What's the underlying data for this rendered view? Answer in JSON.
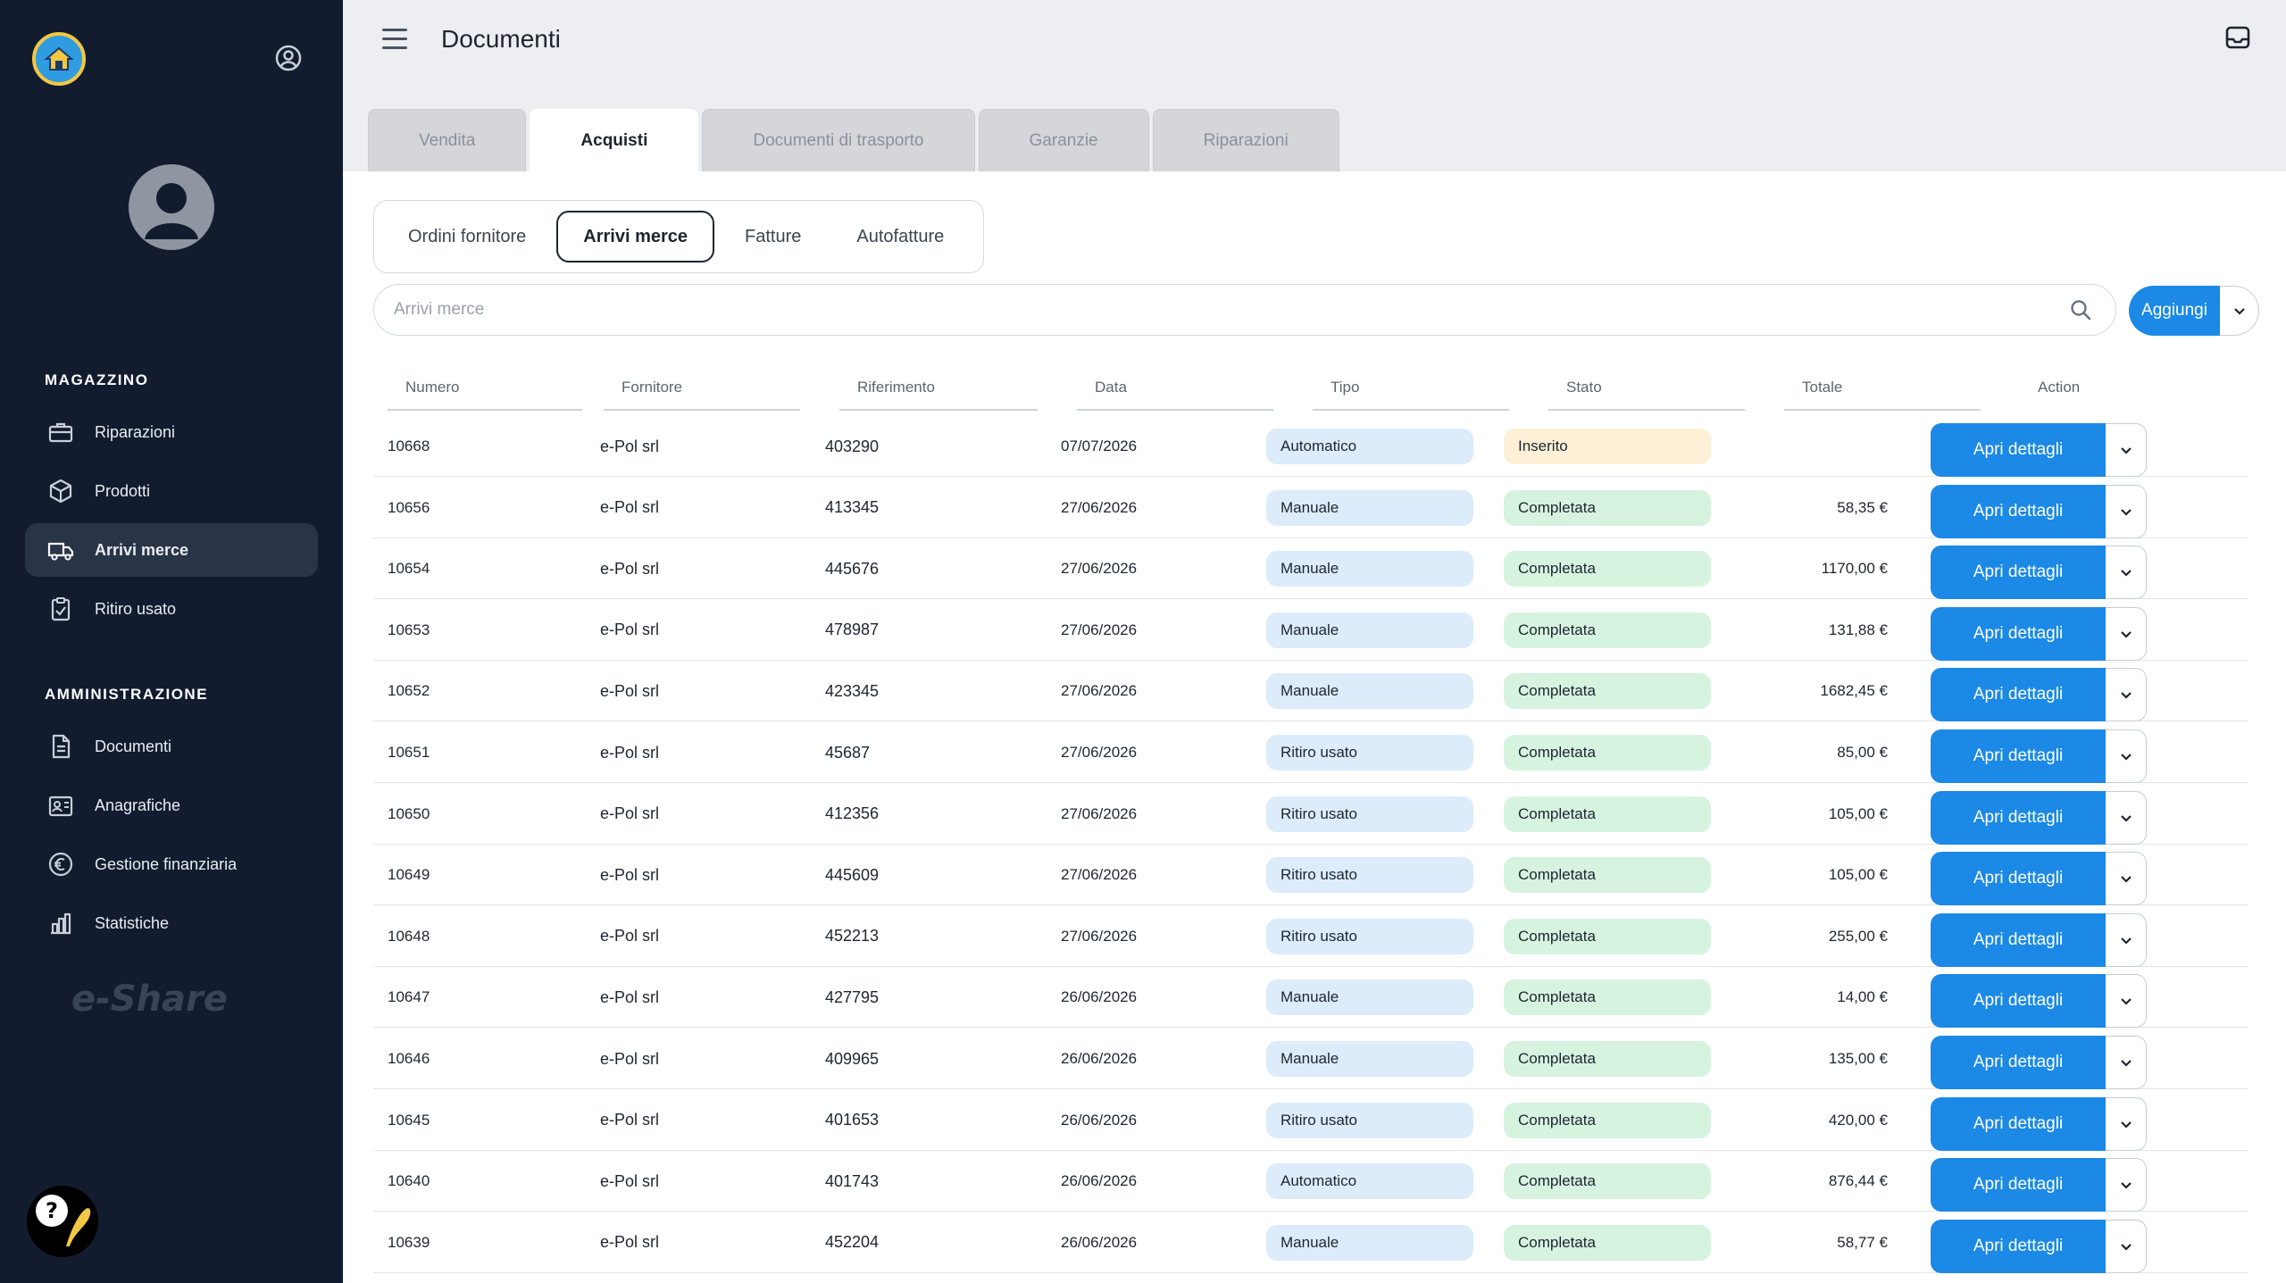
{
  "app": {
    "page_title": "Documenti",
    "brand_watermark": "e-Share"
  },
  "sidebar": {
    "sections": [
      {
        "title": "MAGAZZINO",
        "items": [
          {
            "label": "Riparazioni",
            "icon": "toolbox-icon"
          },
          {
            "label": "Prodotti",
            "icon": "box-icon"
          },
          {
            "label": "Arrivi merce",
            "icon": "truck-icon",
            "active": true
          },
          {
            "label": "Ritiro usato",
            "icon": "clipboard-icon"
          }
        ]
      },
      {
        "title": "AMMINISTRAZIONE",
        "items": [
          {
            "label": "Documenti",
            "icon": "document-icon"
          },
          {
            "label": "Anagrafiche",
            "icon": "contacts-icon"
          },
          {
            "label": "Gestione finanziaria",
            "icon": "euro-icon"
          },
          {
            "label": "Statistiche",
            "icon": "bar-chart-icon"
          }
        ]
      }
    ]
  },
  "tabs": [
    {
      "label": "Vendita",
      "active": false
    },
    {
      "label": "Acquisti",
      "active": true
    },
    {
      "label": "Documenti di trasporto",
      "active": false
    },
    {
      "label": "Garanzie",
      "active": false
    },
    {
      "label": "Riparazioni",
      "active": false
    }
  ],
  "subtabs": [
    {
      "label": "Ordini fornitore",
      "active": false
    },
    {
      "label": "Arrivi merce",
      "active": true
    },
    {
      "label": "Fatture",
      "active": false
    },
    {
      "label": "Autofatture",
      "active": false
    }
  ],
  "search": {
    "placeholder": "Arrivi merce",
    "value": ""
  },
  "add_button": {
    "label": "Aggiungi"
  },
  "table": {
    "columns": [
      "Numero",
      "Fornitore",
      "Riferimento",
      "Data",
      "Tipo",
      "Stato",
      "Totale",
      "Action"
    ],
    "action_label": "Apri dettagli",
    "rows": [
      {
        "numero": "10668",
        "fornitore": "e-Pol srl",
        "riferimento": "403290",
        "data": "07/07/2026",
        "tipo": "Automatico",
        "stato": "Inserito",
        "totale": ""
      },
      {
        "numero": "10656",
        "fornitore": "e-Pol srl",
        "riferimento": "413345",
        "data": "27/06/2026",
        "tipo": "Manuale",
        "stato": "Completata",
        "totale": "58,35 €"
      },
      {
        "numero": "10654",
        "fornitore": "e-Pol srl",
        "riferimento": "445676",
        "data": "27/06/2026",
        "tipo": "Manuale",
        "stato": "Completata",
        "totale": "1170,00 €"
      },
      {
        "numero": "10653",
        "fornitore": "e-Pol srl",
        "riferimento": "478987",
        "data": "27/06/2026",
        "tipo": "Manuale",
        "stato": "Completata",
        "totale": "131,88 €"
      },
      {
        "numero": "10652",
        "fornitore": "e-Pol srl",
        "riferimento": "423345",
        "data": "27/06/2026",
        "tipo": "Manuale",
        "stato": "Completata",
        "totale": "1682,45 €"
      },
      {
        "numero": "10651",
        "fornitore": "e-Pol srl",
        "riferimento": "45687",
        "data": "27/06/2026",
        "tipo": "Ritiro usato",
        "stato": "Completata",
        "totale": "85,00 €"
      },
      {
        "numero": "10650",
        "fornitore": "e-Pol srl",
        "riferimento": "412356",
        "data": "27/06/2026",
        "tipo": "Ritiro usato",
        "stato": "Completata",
        "totale": "105,00 €"
      },
      {
        "numero": "10649",
        "fornitore": "e-Pol srl",
        "riferimento": "445609",
        "data": "27/06/2026",
        "tipo": "Ritiro usato",
        "stato": "Completata",
        "totale": "105,00 €"
      },
      {
        "numero": "10648",
        "fornitore": "e-Pol srl",
        "riferimento": "452213",
        "data": "27/06/2026",
        "tipo": "Ritiro usato",
        "stato": "Completata",
        "totale": "255,00 €"
      },
      {
        "numero": "10647",
        "fornitore": "e-Pol srl",
        "riferimento": "427795",
        "data": "26/06/2026",
        "tipo": "Manuale",
        "stato": "Completata",
        "totale": "14,00 €"
      },
      {
        "numero": "10646",
        "fornitore": "e-Pol srl",
        "riferimento": "409965",
        "data": "26/06/2026",
        "tipo": "Manuale",
        "stato": "Completata",
        "totale": "135,00 €"
      },
      {
        "numero": "10645",
        "fornitore": "e-Pol srl",
        "riferimento": "401653",
        "data": "26/06/2026",
        "tipo": "Ritiro usato",
        "stato": "Completata",
        "totale": "420,00 €"
      },
      {
        "numero": "10640",
        "fornitore": "e-Pol srl",
        "riferimento": "401743",
        "data": "26/06/2026",
        "tipo": "Automatico",
        "stato": "Completata",
        "totale": "876,44 €"
      },
      {
        "numero": "10639",
        "fornitore": "e-Pol srl",
        "riferimento": "452204",
        "data": "26/06/2026",
        "tipo": "Manuale",
        "stato": "Completata",
        "totale": "58,77 €"
      }
    ]
  },
  "colors": {
    "sidebar_bg": "#121c2e",
    "primary": "#1b89e5",
    "tipo_pill": "#dcecfb",
    "stato_completata": "#d6f3e0",
    "stato_inserito": "#fdf0d6"
  }
}
